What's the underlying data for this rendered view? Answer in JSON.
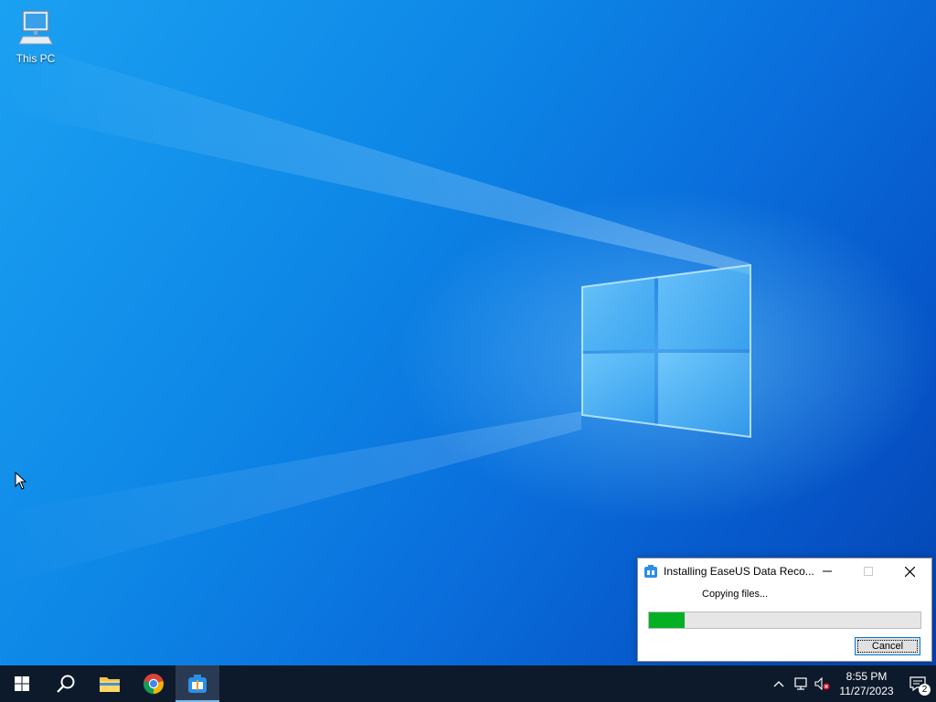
{
  "desktop": {
    "icons": [
      {
        "label": "This PC",
        "icon": "computer-icon"
      }
    ]
  },
  "installer": {
    "title": "Installing EaseUS Data Reco...",
    "status": "Copying files...",
    "progress_percent": 13,
    "cancel_label": "Cancel",
    "window_controls": [
      "minimize",
      "maximize",
      "close"
    ],
    "progress_color": "#06b025"
  },
  "taskbar": {
    "items": [
      {
        "name": "start",
        "icon": "windows-logo-icon"
      },
      {
        "name": "search",
        "icon": "search-icon"
      },
      {
        "name": "file-explorer",
        "icon": "folder-icon"
      },
      {
        "name": "chrome",
        "icon": "chrome-icon"
      },
      {
        "name": "easeus-installer",
        "icon": "installer-icon",
        "active": true
      }
    ],
    "tray": {
      "time": "8:55 PM",
      "date": "11/27/2023",
      "notification_count": "2"
    }
  }
}
